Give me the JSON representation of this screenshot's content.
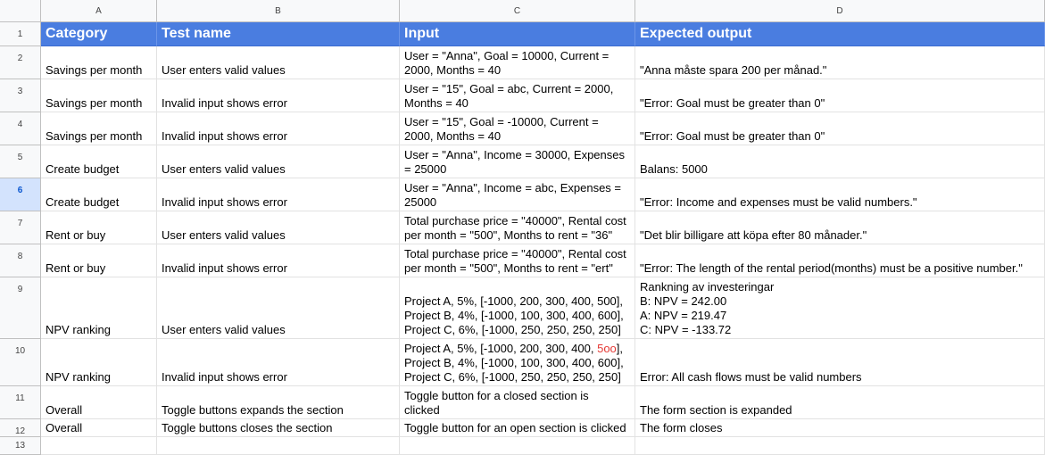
{
  "columns": [
    "A",
    "B",
    "C",
    "D"
  ],
  "header": {
    "row_number": "1",
    "category": "Category",
    "test_name": "Test name",
    "input": "Input",
    "expected_output": "Expected output"
  },
  "rows": [
    {
      "num": "2",
      "category": "Savings per month",
      "test": "User enters valid values",
      "input": [
        "User = \"Anna\", Goal = 10000, Current =",
        "2000, Months = 40"
      ],
      "output": [
        "\"Anna måste spara 200 per månad.\""
      ]
    },
    {
      "num": "3",
      "category": "Savings per month",
      "test": "Invalid input shows error",
      "input": [
        "User = \"15\", Goal = abc, Current = 2000,",
        "Months = 40"
      ],
      "output": [
        "\"Error: Goal must be greater than 0\""
      ]
    },
    {
      "num": "4",
      "category": "Savings per month",
      "test": "Invalid input shows error",
      "input": [
        "User = \"15\", Goal = -10000, Current =",
        "2000, Months = 40"
      ],
      "output": [
        "\"Error: Goal must be greater than 0\""
      ]
    },
    {
      "num": "5",
      "category": "Create budget",
      "test": "User enters valid values",
      "input": [
        "User = \"Anna\", Income = 30000, Expenses",
        "= 25000"
      ],
      "output": [
        "Balans: 5000"
      ]
    },
    {
      "num": "6",
      "category": "Create budget",
      "test": "Invalid input shows error",
      "input": [
        "User = \"Anna\", Income = abc, Expenses =",
        "25000"
      ],
      "output": [
        "\"Error: Income and expenses must be valid numbers.\""
      ]
    },
    {
      "num": "7",
      "category": "Rent or buy",
      "test": "User enters valid values",
      "input": [
        "Total purchase price = \"40000\", Rental cost",
        "per month = \"500\", Months to rent = \"36\""
      ],
      "output": [
        "\"Det blir billigare att köpa efter 80 månader.\""
      ]
    },
    {
      "num": "8",
      "category": "Rent or buy",
      "test": "Invalid input shows error",
      "input": [
        "Total purchase price = \"40000\", Rental cost",
        "per month = \"500\", Months to rent = \"ert\""
      ],
      "output": [
        "\"Error: The length of the rental period(months) must be a positive number.\""
      ]
    },
    {
      "num": "9",
      "category": "NPV ranking",
      "test": "User enters valid values",
      "input": [
        "Project A, 5%, [-1000, 200, 300, 400, 500],",
        "Project B, 4%, [-1000, 100, 300, 400, 600],",
        "Project C, 6%, [-1000, 250, 250, 250, 250]"
      ],
      "output": [
        "Rankning av investeringar",
        "B: NPV = 242.00",
        "A: NPV = 219.47",
        "C: NPV = -133.72"
      ]
    },
    {
      "num": "10",
      "category": "NPV ranking",
      "test": "Invalid input shows error",
      "input_first_prefix": "Project A, 5%, [-1000, 200, 300, 400, ",
      "input_first_red": "5oo",
      "input_first_suffix": "],",
      "input": [
        "Project B, 4%, [-1000, 100, 300, 400, 600],",
        "Project C, 6%, [-1000, 250, 250, 250, 250]"
      ],
      "output": [
        "Error: All cash flows must be valid numbers"
      ]
    },
    {
      "num": "11",
      "category": "Overall",
      "test": "Toggle buttons expands the section",
      "input": [
        "Toggle button for a closed section is",
        "clicked"
      ],
      "output": [
        "The form section is expanded"
      ]
    },
    {
      "num": "12",
      "category": "Overall",
      "test": "Toggle buttons closes the section",
      "input": [
        "Toggle button for an open section is clicked"
      ],
      "output": [
        "The form closes"
      ]
    },
    {
      "num": "13",
      "category": "",
      "test": "",
      "input": [],
      "output": []
    }
  ],
  "selected_row": "6",
  "colors": {
    "header_bg": "#4a7de0",
    "error_highlight": "#e53935",
    "selected_row_header": "#d3e3fd"
  }
}
